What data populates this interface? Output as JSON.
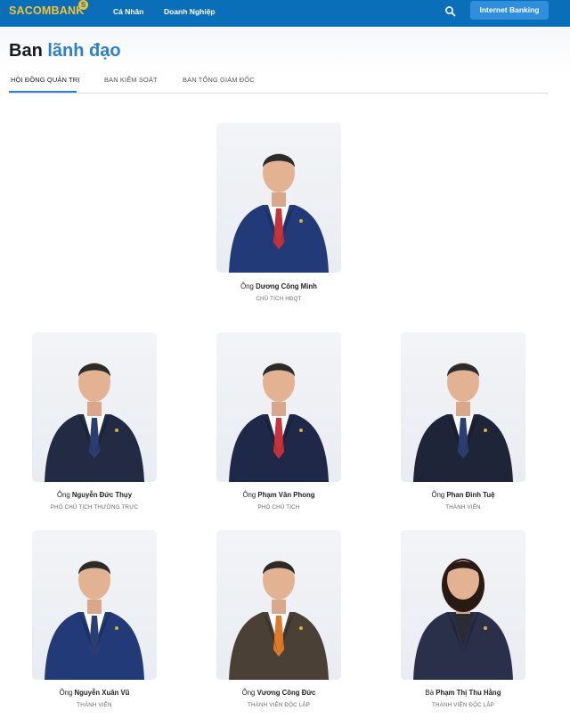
{
  "header": {
    "logo": "SACOMBANK",
    "logo_mark": "S",
    "nav": [
      "Cá Nhân",
      "Doanh Nghiệp"
    ],
    "search_icon": "search-icon",
    "internet_banking": "Internet Banking"
  },
  "title": {
    "main": "Ban",
    "accent": "lãnh đạo"
  },
  "tabs": [
    "HỘI ĐỒNG QUẢN TRỊ",
    "BAN KIỂM SOÁT",
    "BAN TỔNG GIÁM ĐỐC"
  ],
  "active_tab": "HỘI ĐỒNG QUẢN TRỊ",
  "colors": {
    "header_bg": "#0a6fb8",
    "logo": "#f3c233",
    "button": "#2f8fdc",
    "accent": "#2d7fd0"
  },
  "members": [
    {
      "prefix": "Ông",
      "name": "Dương Công Minh",
      "role": "CHỦ TỊCH HĐQT",
      "tie": "#c8323a",
      "suit": "#223a78",
      "shirt": "#ffffff"
    },
    {
      "prefix": "Ông",
      "name": "Nguyễn Đức Thụy",
      "role": "PHÓ CHỦ TỊCH THƯỜNG TRỰC",
      "tie": "#2a3e72",
      "suit": "#232b44",
      "shirt": "#ffffff"
    },
    {
      "prefix": "Ông",
      "name": "Phạm Văn Phong",
      "role": "PHÓ CHỦ TỊCH",
      "tie": "#c8323a",
      "suit": "#20284a",
      "shirt": "#ffffff"
    },
    {
      "prefix": "Ông",
      "name": "Phan Đình Tuệ",
      "role": "THÀNH VIÊN",
      "tie": "#2a3e72",
      "suit": "#1f2538",
      "shirt": "#ffffff"
    },
    {
      "prefix": "Ông",
      "name": "Nguyễn Xuân Vũ",
      "role": "THÀNH VIÊN",
      "tie": "#2a3e72",
      "suit": "#233a78",
      "shirt": "#ffffff"
    },
    {
      "prefix": "Ông",
      "name": "Vương Công Đức",
      "role": "THÀNH VIÊN ĐỘC LẬP",
      "tie": "#e07a2a",
      "suit": "#4a4036",
      "shirt": "#ffffff"
    },
    {
      "prefix": "Bà",
      "name": "Phạm Thị Thu Hằng",
      "role": "THÀNH VIÊN ĐỘC LẬP",
      "tie": "#1b1b24",
      "suit": "#2a2f4a",
      "shirt": "#2b2b33"
    }
  ]
}
